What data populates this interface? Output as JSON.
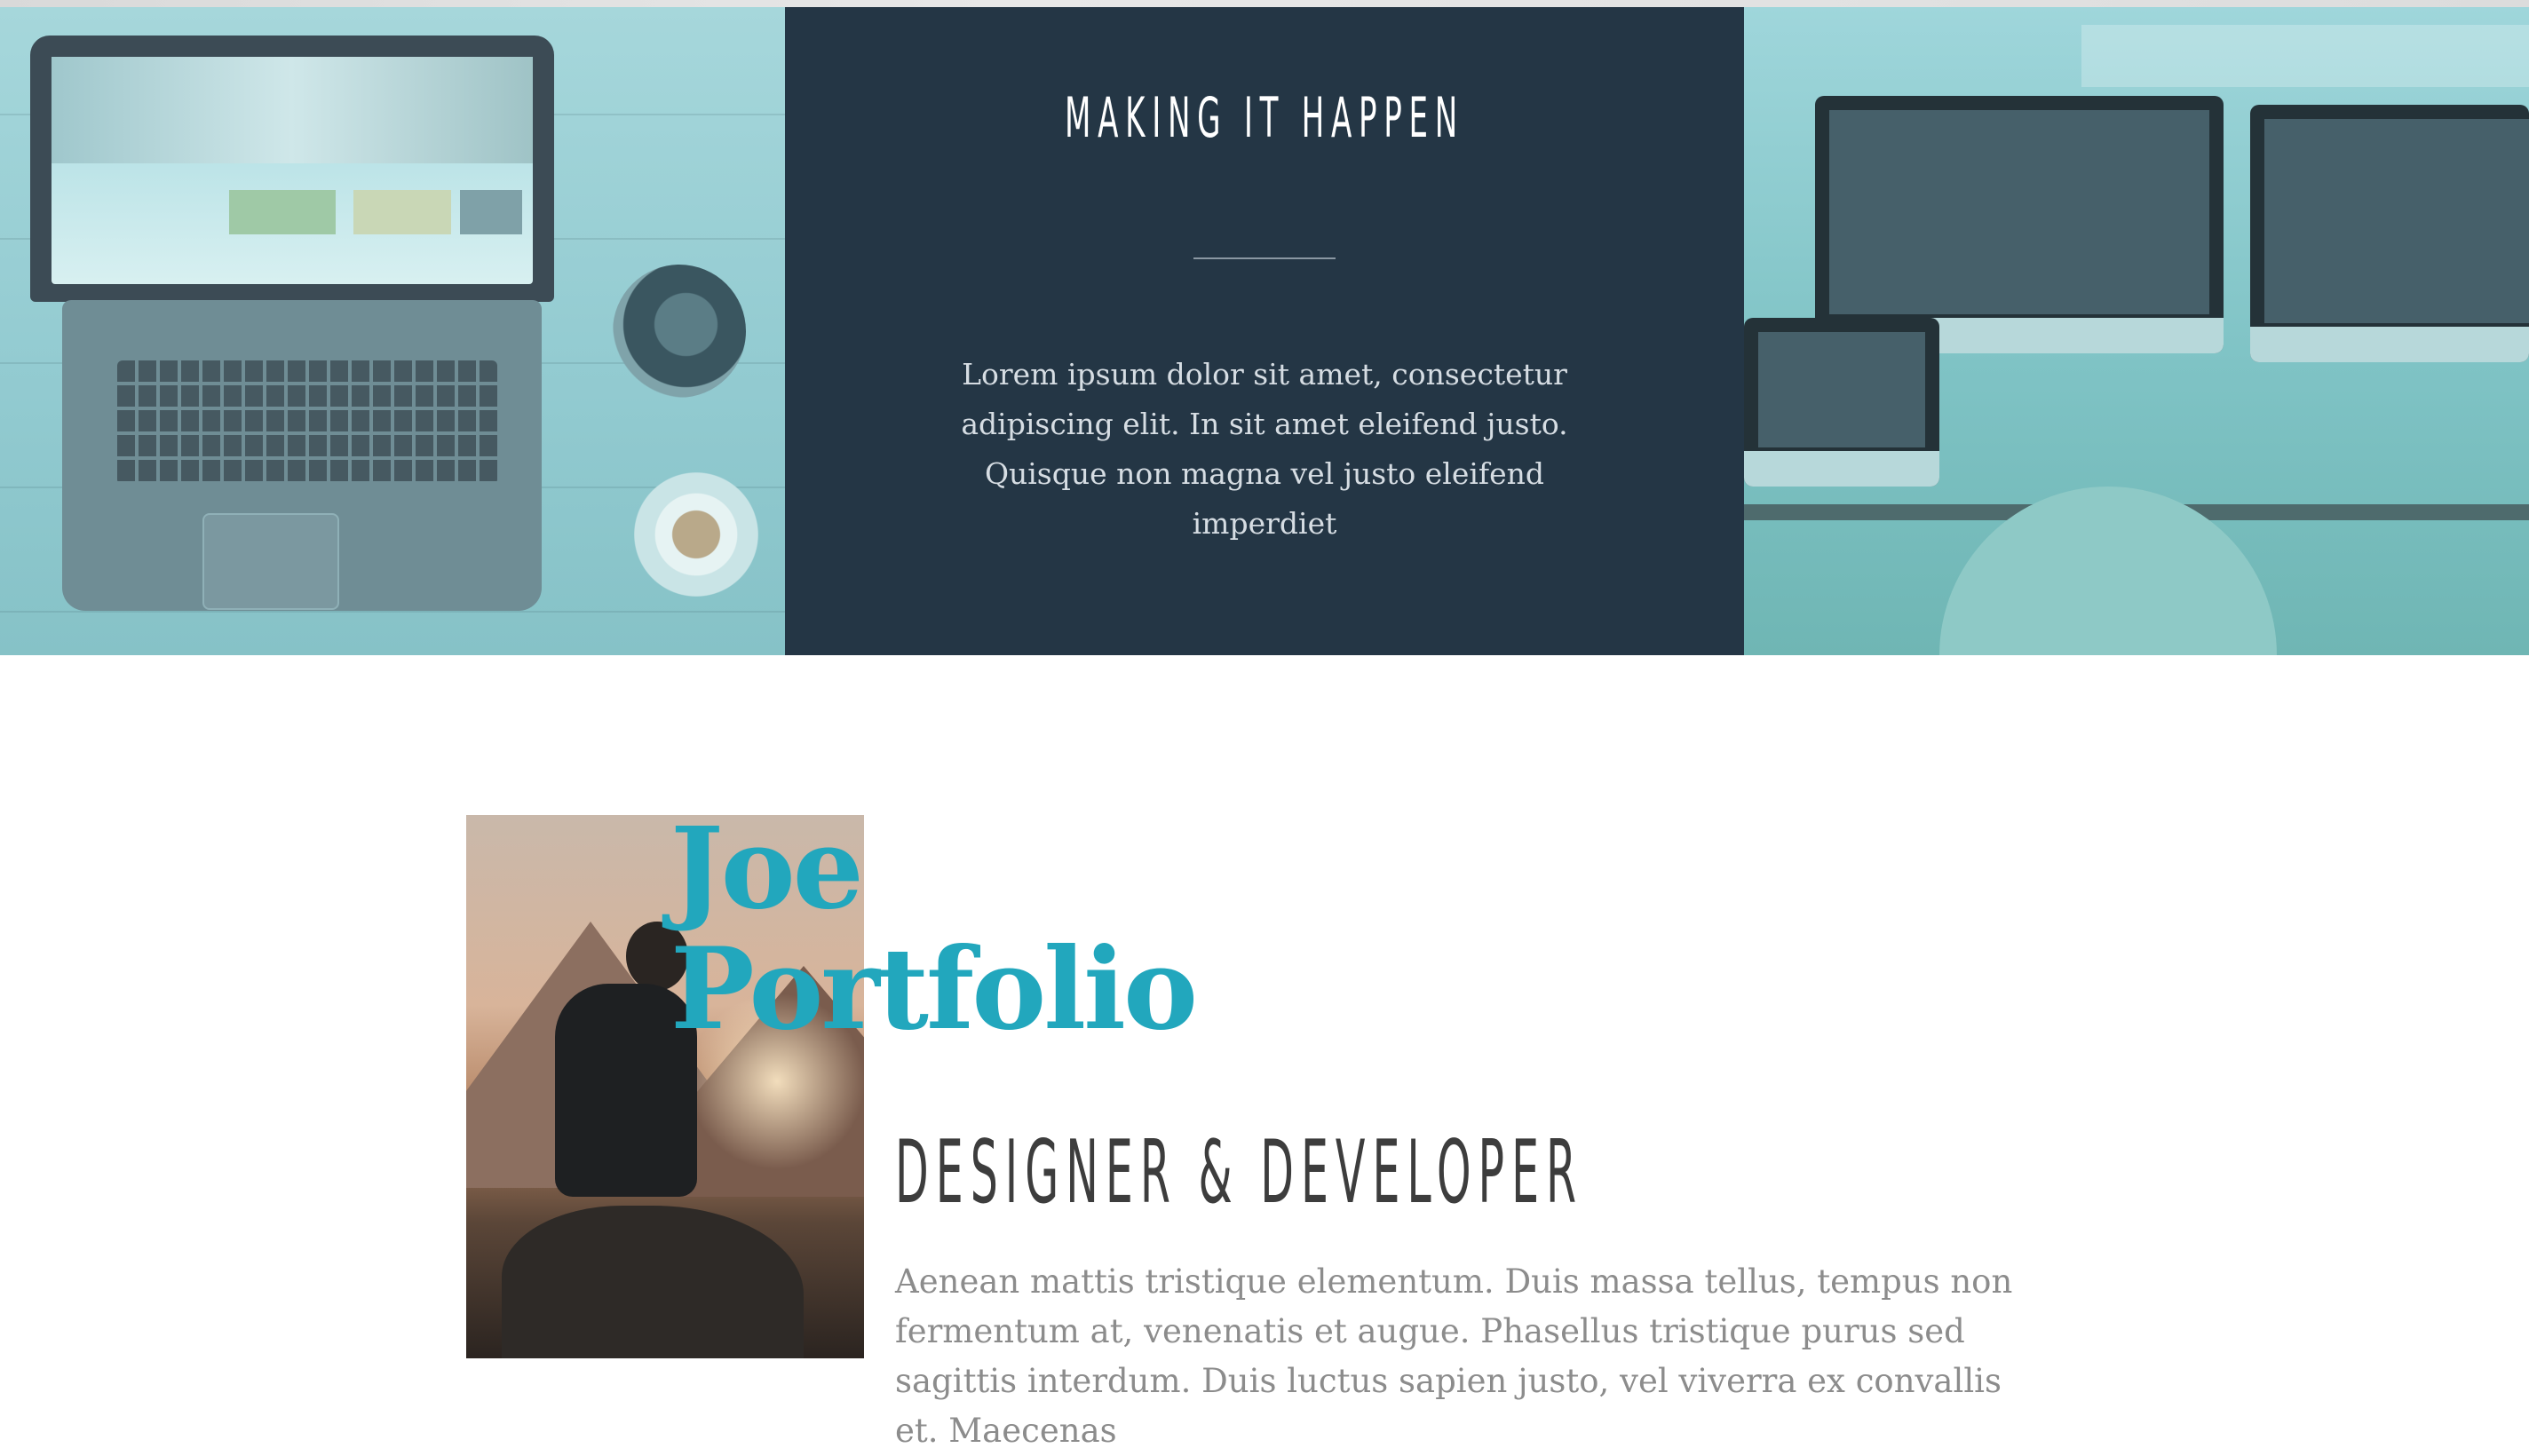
{
  "hero": {
    "title": "MAKING IT HAPPEN",
    "text": "Lorem ipsum dolor sit amet, consectetur adipiscing elit. In sit amet eleifend justo. Quisque non magna vel justo eleifend imperdiet"
  },
  "about": {
    "name": "Joe\nPortfolio",
    "role": "DESIGNER & DEVELOPER",
    "text": "Aenean mattis tristique elementum. Duis massa tellus, tempus non fermentum at, venenatis et augue. Phasellus tristique purus sed sagittis interdum. Duis luctus sapien justo, vel viverra ex convallis et. Maecenas"
  },
  "colors": {
    "hero_center_bg": "#243645",
    "accent": "#22a7bd",
    "hero_overlay": "#93cbd1",
    "role_text": "#3d3d3d",
    "body_text": "#8c8c8c"
  }
}
